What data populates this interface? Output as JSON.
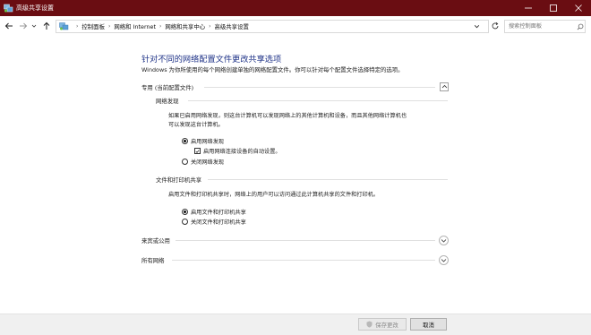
{
  "window": {
    "title": "高级共享设置"
  },
  "nav": {
    "breadcrumbs": [
      "控制面板",
      "网络和 Internet",
      "网络和共享中心",
      "高级共享设置"
    ],
    "search_placeholder": "搜索控制面板"
  },
  "main": {
    "heading": "针对不同的网络配置文件更改共享选项",
    "description": "Windows 为你所使用的每个网络创建单独的网络配置文件。你可以针对每个配置文件选择特定的选项。",
    "private_profile": {
      "label": "专用 (当前配置文件)",
      "expanded": true,
      "network_discovery": {
        "label": "网络发现",
        "desc_line1": "如果已启用网络发现，则这台计算机可以发现网络上的其他计算机和设备，而且其他网络计算机也",
        "desc_line2": "可以发现这台计算机。",
        "option_on": "启用网络发现",
        "auto_setup": "启用网络连接设备的自动设置。",
        "auto_setup_checked": true,
        "option_off": "关闭网络发现",
        "selected": "on"
      },
      "file_printer_sharing": {
        "label": "文件和打印机共享",
        "desc": "启用文件和打印机共享时，网络上的用户可以访问通过此计算机共享的文件和打印机。",
        "option_on": "启用文件和打印机共享",
        "option_off": "关闭文件和打印机共享",
        "selected": "on"
      }
    },
    "guest_public": {
      "label": "来宾或公用",
      "expanded": false
    },
    "all_networks": {
      "label": "所有网络",
      "expanded": false
    }
  },
  "footer": {
    "save_label": "保存更改",
    "save_enabled": false,
    "cancel_label": "取消"
  },
  "colors": {
    "titlebar": "#6a0d12",
    "heading": "#1e3287"
  }
}
